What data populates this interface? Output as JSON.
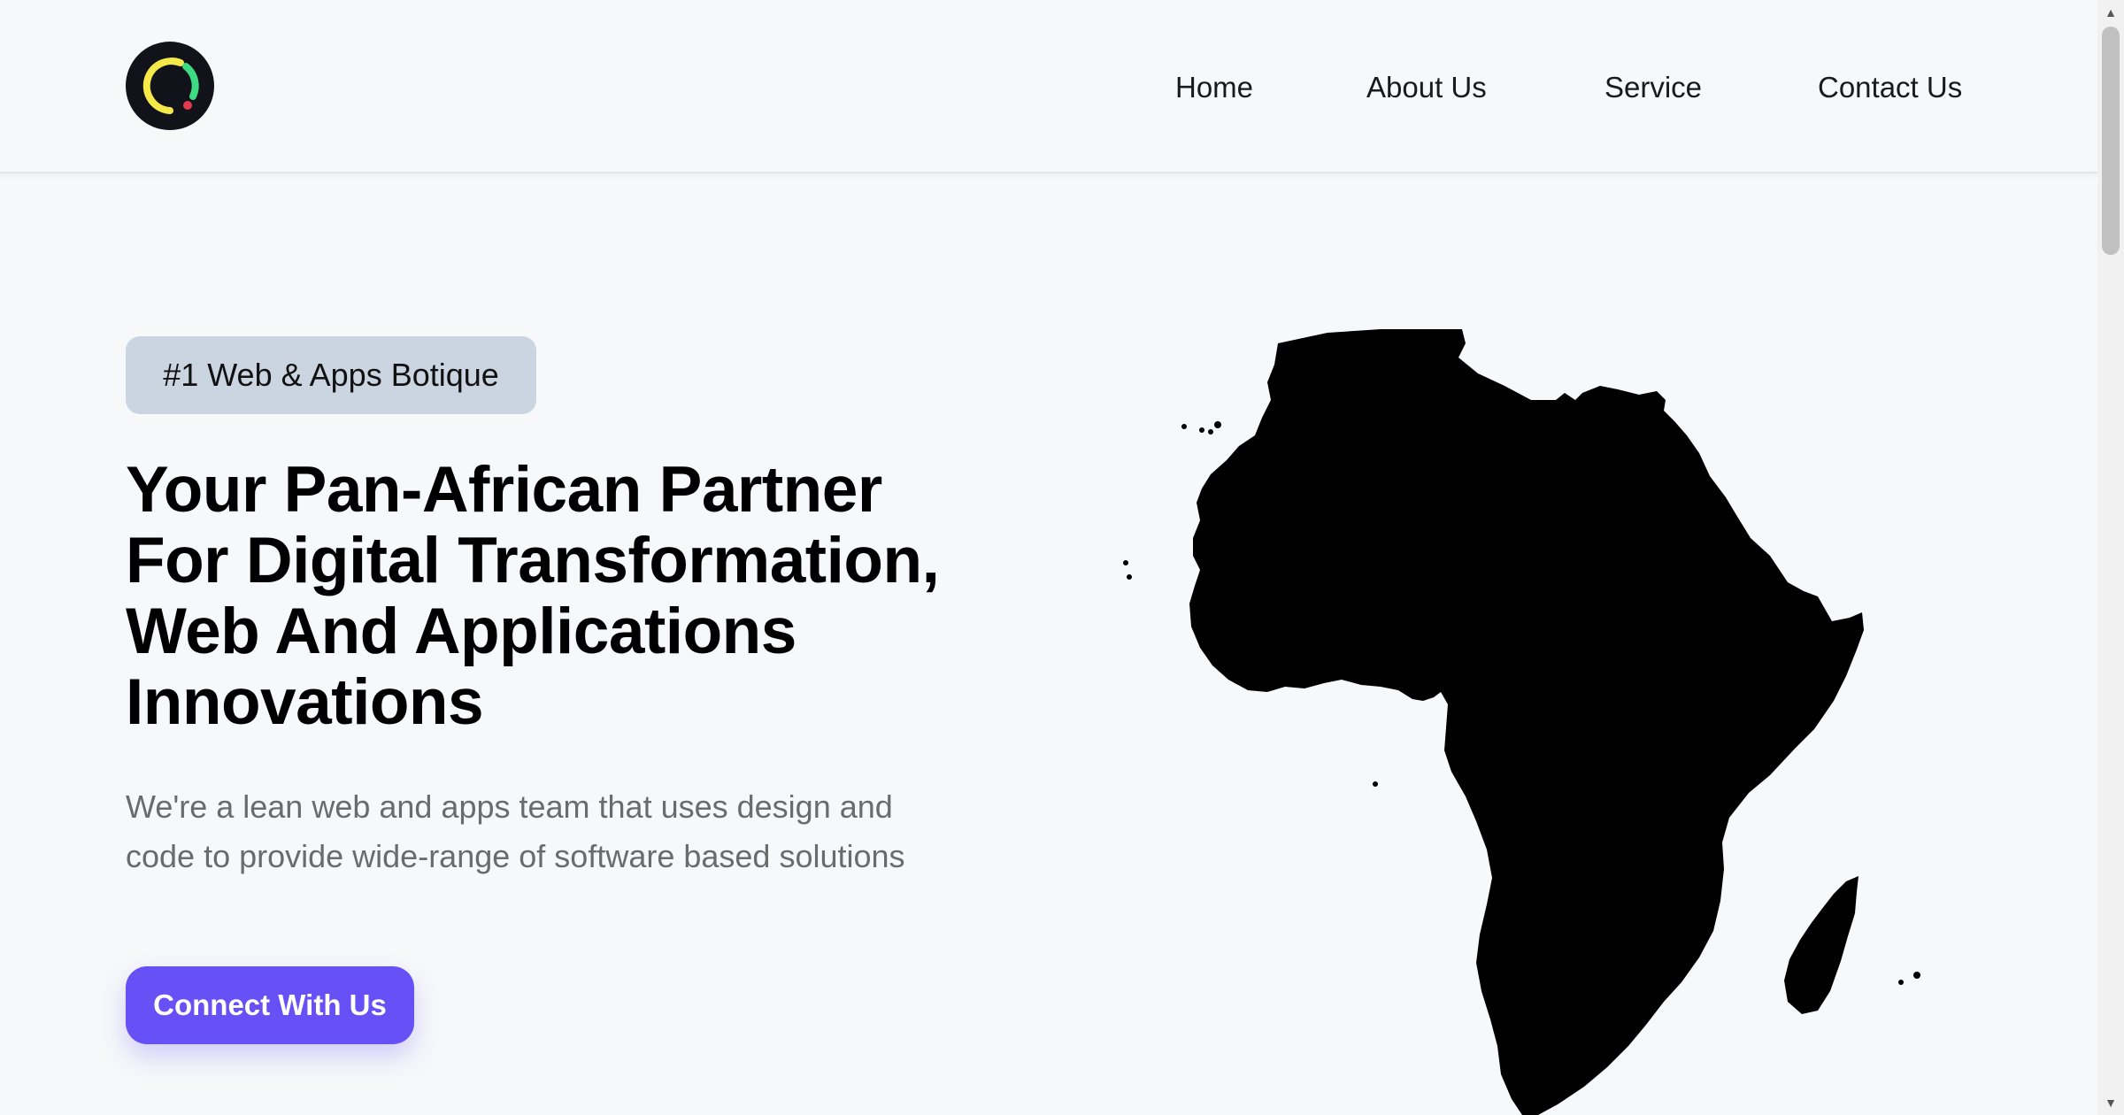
{
  "nav": {
    "items": [
      {
        "label": "Home"
      },
      {
        "label": "About Us"
      },
      {
        "label": "Service"
      },
      {
        "label": "Contact Us"
      }
    ]
  },
  "hero": {
    "badge": "#1 Web & Apps Botique",
    "headline_lines": [
      "Your Pan-African Partner",
      "For Digital Transformation,",
      "Web And Applications",
      "Innovations"
    ],
    "subtext_lines": [
      "We're a lean web and apps team that uses design and",
      "code to provide wide-range of software based solutions"
    ],
    "cta_label": "Connect With Us"
  },
  "colors": {
    "background": "#f7f8fa",
    "badge_bg": "#cbd5e1",
    "cta_bg": "#6750f5",
    "logo_ring_yellow": "#f5e94a",
    "logo_ring_green": "#3ddc84",
    "logo_dot_red": "#e53950"
  },
  "icons": {
    "logo": "brand-logo-ring-icon",
    "map": "africa-map",
    "scroll_up": "scroll-up-arrow-icon",
    "scroll_down": "scroll-down-arrow-icon"
  }
}
